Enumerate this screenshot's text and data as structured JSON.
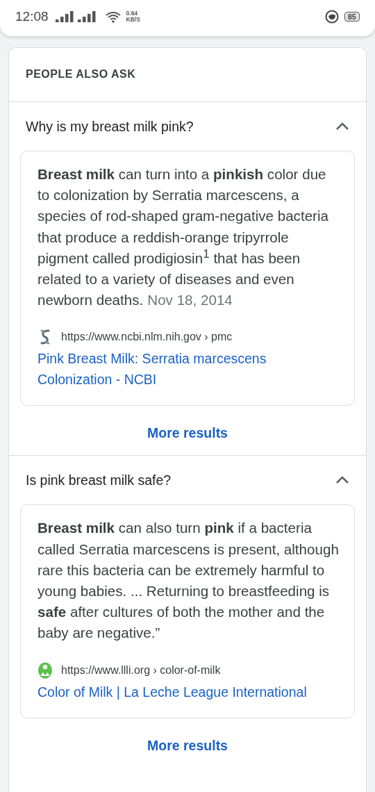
{
  "status_bar": {
    "time": "12:08",
    "net_speed": "0.64",
    "net_unit": "KB/S",
    "battery": "85"
  },
  "section": {
    "title": "PEOPLE ALSO ASK",
    "questions": [
      {
        "question": "Why is my breast milk pink?",
        "expanded": true,
        "answer": "**Breast milk** can turn into a **pinkish** color due to colonization by Serratia marcescens, a species of rod-shaped gram-negative bacteria that produce a reddish-orange tripyrrole pigment called prodigiosin$^{1}$ that has been related to a variety of diseases and even newborn deaths.",
        "date": "Nov 18, 2014",
        "kind": "ncbi",
        "url": "https://www.ncbi.nlm.nih.gov › pmc",
        "link": "Pink Breast Milk: Serratia marcescens Colonization - NCBI",
        "more": "More results"
      },
      {
        "question": "Is pink breast milk safe?",
        "expanded": true,
        "answer": "**Breast milk** can also turn **pink** if a bacteria called Serratia marcescens is present, although rare this bacteria can be extremely harmful to young babies. ... Returning to breastfeeding is **safe** after cultures of both the mother and the baby are negative.”",
        "kind": "llli",
        "url": "https://www.llli.org › color-of-milk",
        "link": "Color of Milk | La Leche League International",
        "more": "More results"
      }
    ]
  }
}
